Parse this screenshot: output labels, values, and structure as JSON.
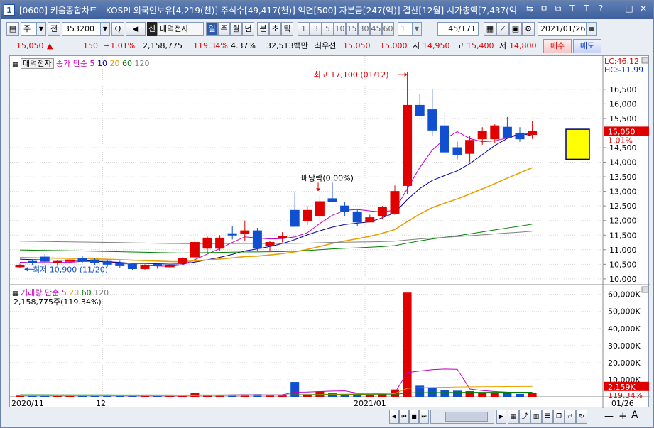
{
  "window": {
    "number": "1",
    "title": "[0600] 키움종합차트 - KOSPI 외국인보유[4,219(천)] 주식수[49,417(천)] 액면[500] 자본금[247(억)] 결산[12월] 시가총액[7,437(억"
  },
  "titlebar_icons": [
    "⇆",
    "ㅁ",
    "⧉",
    "T",
    "T",
    "?",
    "—",
    "□",
    "✕"
  ],
  "toolbar": {
    "period_select": "주",
    "price_type": "전",
    "stock_code": "353200",
    "search_icon_label": "Q",
    "speaker_icon_label": "◀",
    "stock_badge": "신",
    "stock_name": "대덕전자",
    "period_buttons": [
      "일",
      "주",
      "월",
      "년",
      "분",
      "초",
      "틱"
    ],
    "interval_buttons": [
      "1",
      "3",
      "5",
      "10",
      "15",
      "30",
      "45",
      "60"
    ],
    "count_value": "1",
    "page_indicator": "45/171",
    "date_value": "2021/01/26"
  },
  "quote": {
    "price": "15,050",
    "arrow": "▲",
    "change": "150",
    "change_pct": "+1.01%",
    "volume": "2,158,775",
    "volume_ratio": "119.34%",
    "turnover": "4.37%",
    "amount": "32,513백만",
    "best_bid_label": "최우선",
    "best_ask": "15,050",
    "best_bid": "15,000",
    "open_label": "시",
    "open": "14,950",
    "high_label": "고",
    "high": "15,400",
    "low_label": "저",
    "low": "14,800",
    "buy_label": "매수",
    "sell_label": "매도"
  },
  "price_panel": {
    "stock_tag": "대덕전자",
    "legend_prefix": "종가 단순",
    "ma_periods": [
      "5",
      "10",
      "20",
      "60",
      "120"
    ],
    "ma_colors": [
      "#c000c0",
      "#0000a0",
      "#e8a000",
      "#008000",
      "#808080"
    ],
    "lc_label": "LC:46.12",
    "hc_label": "HC:-11.99",
    "current_price_tag": "15,050",
    "current_pct_tag": "1.01%",
    "high_annotation": "최고 17,100 (01/12)",
    "low_annotation": "최저 10,900 (11/20)",
    "dividend_annotation": "배당락(0.00%)"
  },
  "volume_panel": {
    "title": "거래량",
    "legend_prefix": "단순",
    "volume_readout": "2,158,775주(119.34%)",
    "current_volume_tag": "2,159K",
    "current_pct_tag": "119.34%"
  },
  "x_axis": {
    "labels": [
      "2020/11",
      "12",
      "2021/01",
      "01/26"
    ]
  },
  "chart_data": {
    "type": "candlestick",
    "price_axis": {
      "ticks": [
        "16,500",
        "16,000",
        "15,500",
        "15,000",
        "14,500",
        "14,000",
        "13,500",
        "13,000",
        "12,500",
        "12,000",
        "11,500",
        "11,000",
        "10,500",
        "10,000"
      ],
      "ylim": [
        9900,
        17250
      ]
    },
    "volume_axis": {
      "ticks": [
        "60,000K",
        "50,000K",
        "40,000K",
        "30,000K",
        "20,000K",
        "10,000K"
      ],
      "ylim": [
        0,
        64000
      ]
    },
    "candles": [
      {
        "o": 10450,
        "h": 10520,
        "l": 10380,
        "c": 10450
      },
      {
        "o": 10600,
        "h": 10680,
        "l": 10480,
        "c": 10550
      },
      {
        "o": 10750,
        "h": 10850,
        "l": 10550,
        "c": 10600
      },
      {
        "o": 10550,
        "h": 10650,
        "l": 10450,
        "c": 10600
      },
      {
        "o": 10600,
        "h": 10700,
        "l": 10500,
        "c": 10650
      },
      {
        "o": 10700,
        "h": 10780,
        "l": 10550,
        "c": 10600
      },
      {
        "o": 10650,
        "h": 10700,
        "l": 10480,
        "c": 10550
      },
      {
        "o": 10600,
        "h": 10650,
        "l": 10420,
        "c": 10500
      },
      {
        "o": 10550,
        "h": 10620,
        "l": 10380,
        "c": 10450
      },
      {
        "o": 10500,
        "h": 10550,
        "l": 10300,
        "c": 10350
      },
      {
        "o": 10350,
        "h": 10500,
        "l": 10300,
        "c": 10450
      },
      {
        "o": 10500,
        "h": 10550,
        "l": 10350,
        "c": 10450
      },
      {
        "o": 10450,
        "h": 10500,
        "l": 10380,
        "c": 10450
      },
      {
        "o": 10550,
        "h": 10750,
        "l": 10500,
        "c": 10700
      },
      {
        "o": 10750,
        "h": 11400,
        "l": 10700,
        "c": 11250
      },
      {
        "o": 11050,
        "h": 11450,
        "l": 10900,
        "c": 11400
      },
      {
        "o": 11050,
        "h": 11500,
        "l": 10950,
        "c": 11400
      },
      {
        "o": 11550,
        "h": 11800,
        "l": 11350,
        "c": 11500
      },
      {
        "o": 11550,
        "h": 12000,
        "l": 11300,
        "c": 11650
      },
      {
        "o": 11650,
        "h": 11750,
        "l": 10950,
        "c": 11050
      },
      {
        "o": 11150,
        "h": 11300,
        "l": 10950,
        "c": 11250
      },
      {
        "o": 11400,
        "h": 11600,
        "l": 11250,
        "c": 11450
      },
      {
        "o": 12350,
        "h": 12950,
        "l": 11800,
        "c": 11800
      },
      {
        "o": 12000,
        "h": 12500,
        "l": 11850,
        "c": 12350
      },
      {
        "o": 12150,
        "h": 12850,
        "l": 12050,
        "c": 12650
      },
      {
        "o": 12750,
        "h": 13300,
        "l": 12650,
        "c": 12650
      },
      {
        "o": 12500,
        "h": 12650,
        "l": 12150,
        "c": 12300
      },
      {
        "o": 12300,
        "h": 12400,
        "l": 11800,
        "c": 11950
      },
      {
        "o": 11950,
        "h": 12200,
        "l": 11950,
        "c": 12100
      },
      {
        "o": 12150,
        "h": 12500,
        "l": 12050,
        "c": 12450
      },
      {
        "o": 12250,
        "h": 13200,
        "l": 12200,
        "c": 13000
      },
      {
        "o": 13200,
        "h": 17100,
        "l": 12900,
        "c": 15950
      },
      {
        "o": 15950,
        "h": 16350,
        "l": 15600,
        "c": 15600
      },
      {
        "o": 15800,
        "h": 16500,
        "l": 14900,
        "c": 15100
      },
      {
        "o": 15250,
        "h": 15700,
        "l": 14300,
        "c": 14350
      },
      {
        "o": 14500,
        "h": 14700,
        "l": 14100,
        "c": 14250
      },
      {
        "o": 14300,
        "h": 14900,
        "l": 14000,
        "c": 14750
      },
      {
        "o": 14800,
        "h": 15200,
        "l": 14600,
        "c": 15050
      },
      {
        "o": 14800,
        "h": 15300,
        "l": 14650,
        "c": 15250
      },
      {
        "o": 15200,
        "h": 15550,
        "l": 14950,
        "c": 14850
      },
      {
        "o": 15000,
        "h": 15200,
        "l": 14700,
        "c": 14800
      },
      {
        "o": 14950,
        "h": 15400,
        "l": 14800,
        "c": 15050
      }
    ],
    "volumes": [
      700,
      650,
      600,
      600,
      700,
      650,
      600,
      550,
      600,
      500,
      550,
      600,
      500,
      700,
      2100,
      1100,
      800,
      1100,
      1200,
      1500,
      1100,
      1200,
      8700,
      1500,
      3200,
      2400,
      1700,
      2000,
      1400,
      2300,
      4300,
      61000,
      6500,
      5500,
      3900,
      3600,
      3300,
      2200,
      2500,
      2200,
      1700,
      2159
    ]
  }
}
